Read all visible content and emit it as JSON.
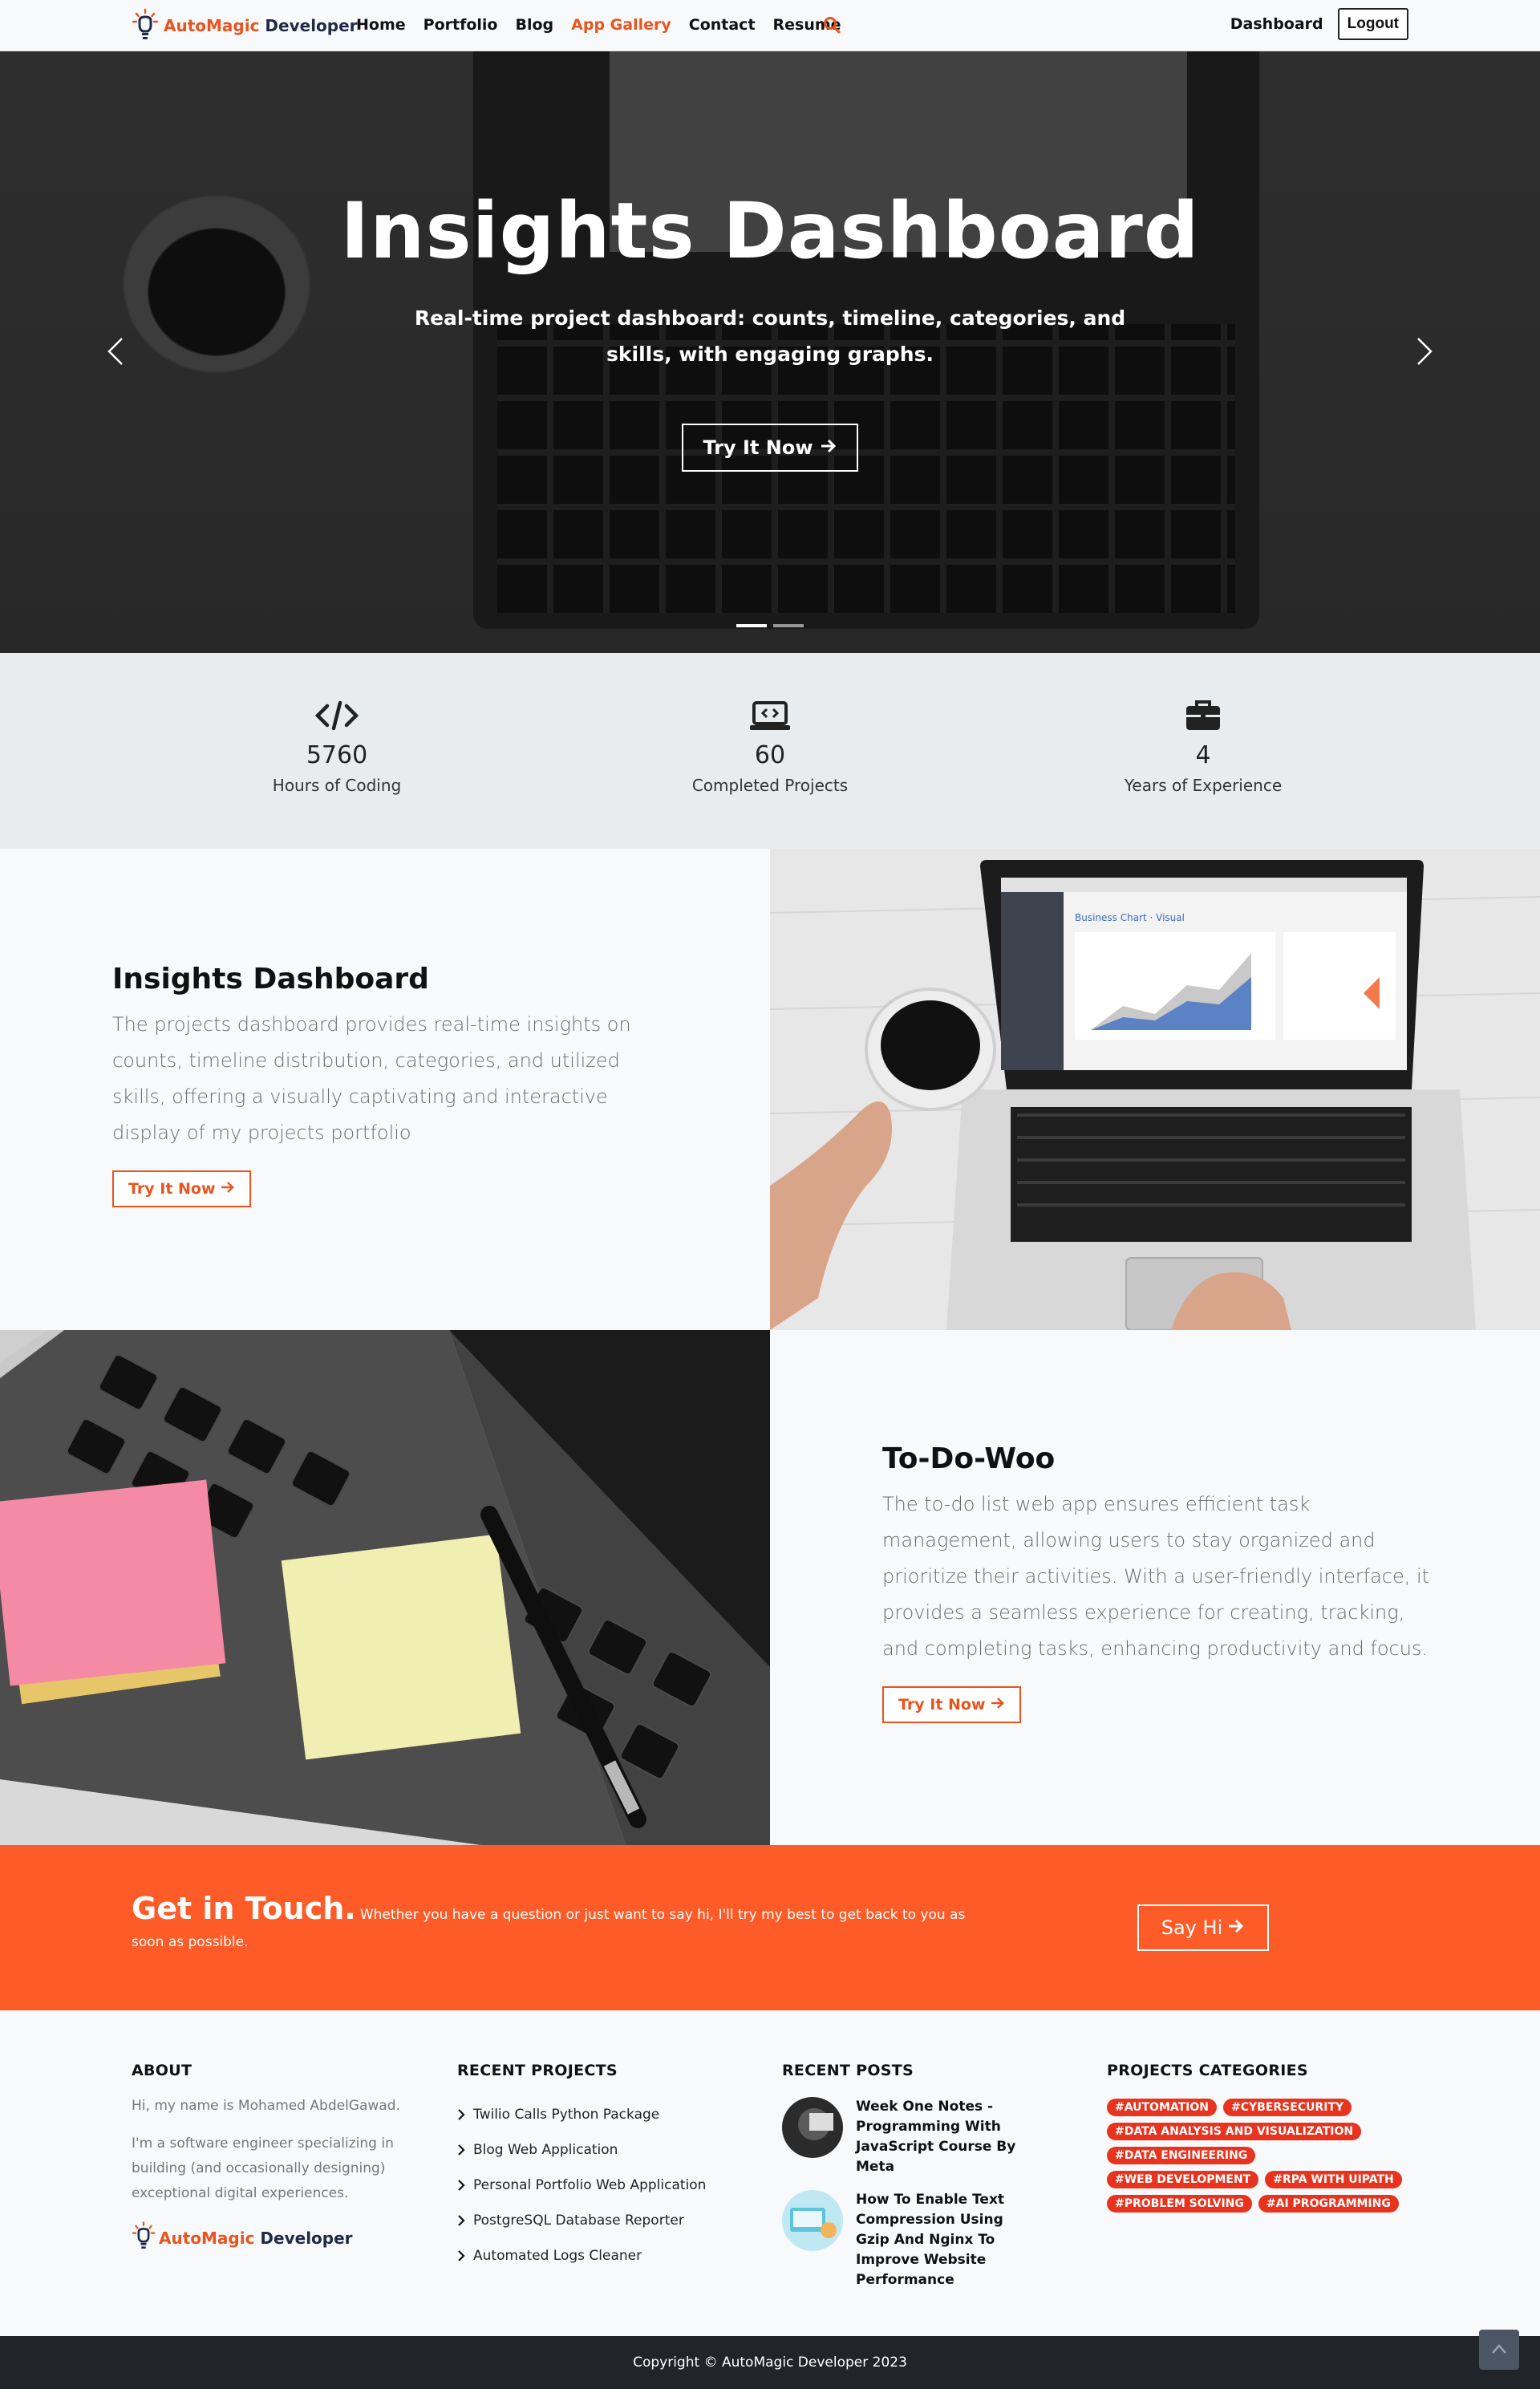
{
  "nav": {
    "brand_part1": "AutoMagic",
    "brand_part2": "Developer",
    "links": [
      "Home",
      "Portfolio",
      "Blog",
      "App Gallery",
      "Contact",
      "Resume"
    ],
    "active_link": "App Gallery",
    "dashboard": "Dashboard",
    "logout": "Logout"
  },
  "hero": {
    "title": "Insights Dashboard",
    "subtitle": "Real-time project dashboard: counts, timeline, categories, and skills, with engaging graphs.",
    "button": "Try It Now",
    "slides": 2,
    "active_slide": 1
  },
  "stats": [
    {
      "icon": "code-icon",
      "value": "5760",
      "label": "Hours of Coding"
    },
    {
      "icon": "laptop-code-icon",
      "value": "60",
      "label": "Completed Projects"
    },
    {
      "icon": "briefcase-icon",
      "value": "4",
      "label": "Years of Experience"
    }
  ],
  "features": [
    {
      "title": "Insights Dashboard",
      "description": "The projects dashboard provides real-time insights on counts, timeline distribution, categories, and utilized skills, offering a visually captivating and interactive display of my projects portfolio",
      "button": "Try It Now"
    },
    {
      "title": "To-Do-Woo",
      "description": "The to-do list web app ensures efficient task management, allowing users to stay organized and prioritize their activities. With a user-friendly interface, it provides a seamless experience for creating, tracking, and completing tasks, enhancing productivity and focus.",
      "button": "Try It Now"
    }
  ],
  "touch": {
    "title": "Get in Touch.",
    "text": "Whether you have a question or just want to say hi, I'll try my best to get back to you as soon as possible.",
    "button": "Say Hi"
  },
  "footer": {
    "about": {
      "heading": "ABOUT",
      "p1": "Hi, my name is Mohamed AbdelGawad.",
      "p2": "I'm a software engineer specializing in building (and occasionally designing) exceptional digital experiences."
    },
    "recent_projects": {
      "heading": "RECENT PROJECTS",
      "items": [
        "Twilio Calls Python Package",
        "Blog Web Application",
        "Personal Portfolio Web Application",
        "PostgreSQL Database Reporter",
        "Automated Logs Cleaner"
      ]
    },
    "recent_posts": {
      "heading": "RECENT POSTS",
      "items": [
        "Week One Notes - Programming With JavaScript Course By Meta",
        "How To Enable Text Compression Using Gzip And Nginx To Improve Website Performance"
      ]
    },
    "categories": {
      "heading": "PROJECTS CATEGORIES",
      "tags": [
        "#AUTOMATION",
        "#CYBERSECURITY",
        "#DATA ANALYSIS AND VISUALIZATION",
        "#DATA ENGINEERING",
        "#WEB DEVELOPMENT",
        "#RPA WITH UIPATH",
        "#PROBLEM SOLVING",
        "#AI PROGRAMMING"
      ]
    }
  },
  "copyright": "Copyright © AutoMagic Developer 2023",
  "colors": {
    "accent": "#e8541f",
    "touch_bg": "#fd5c28",
    "tag_bg": "#e8341f",
    "footer_dark": "#212529"
  }
}
